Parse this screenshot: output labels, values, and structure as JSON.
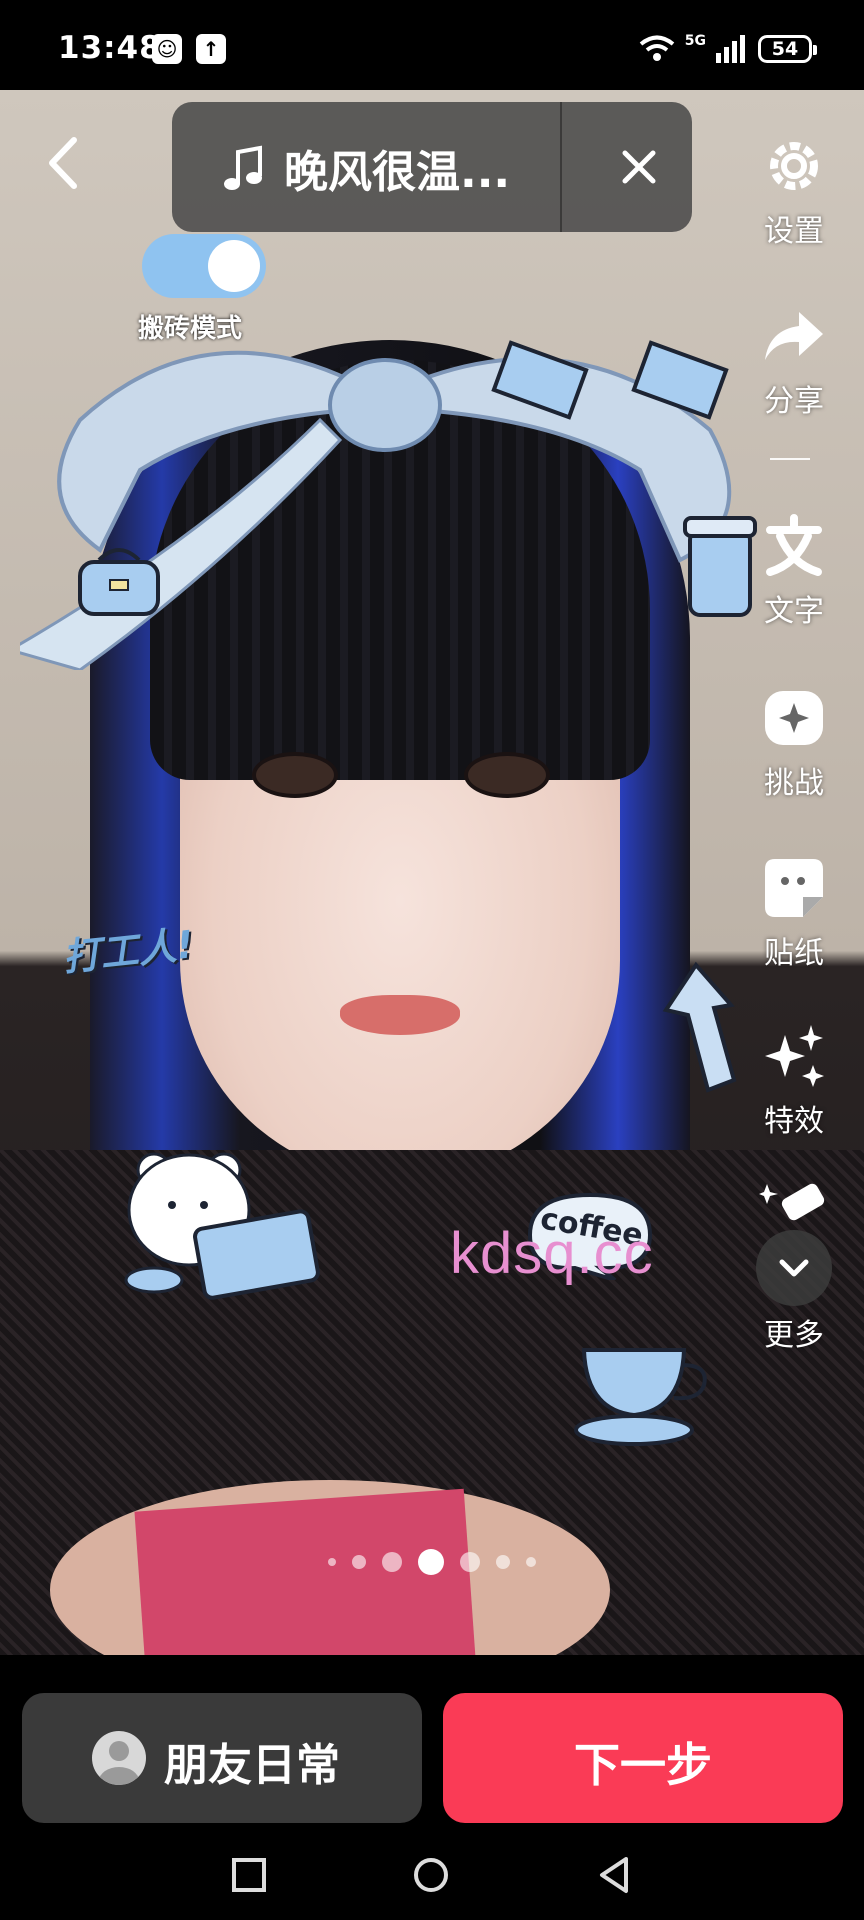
{
  "status_bar": {
    "time": "13:48",
    "network": "5G",
    "battery": "54"
  },
  "music": {
    "title": "晚风很温..."
  },
  "mode_toggle": {
    "label": "搬砖模式",
    "on": true
  },
  "side_tools": [
    {
      "label": "设置",
      "icon": "gear-icon"
    },
    {
      "label": "分享",
      "icon": "share-icon"
    },
    {
      "label": "文字",
      "icon": "text-icon"
    },
    {
      "label": "挑战",
      "icon": "challenge-icon"
    },
    {
      "label": "贴纸",
      "icon": "sticker-icon"
    },
    {
      "label": "特效",
      "icon": "sparkle-icon"
    },
    {
      "label": "更多",
      "icon": "chevron-down-icon"
    }
  ],
  "stickers": {
    "work_text": "打工人!",
    "coffee_text": "coffee"
  },
  "watermark": "kdsq.cc",
  "carousel": {
    "count": 7,
    "active_index": 3
  },
  "actions": {
    "friends_label": "朋友日常",
    "next_label": "下一步"
  },
  "colors": {
    "next_button": "#fa3b56",
    "friends_button": "#3a3a3a",
    "toggle_on": "#8fc3f0",
    "watermark": "#e78fd0"
  }
}
